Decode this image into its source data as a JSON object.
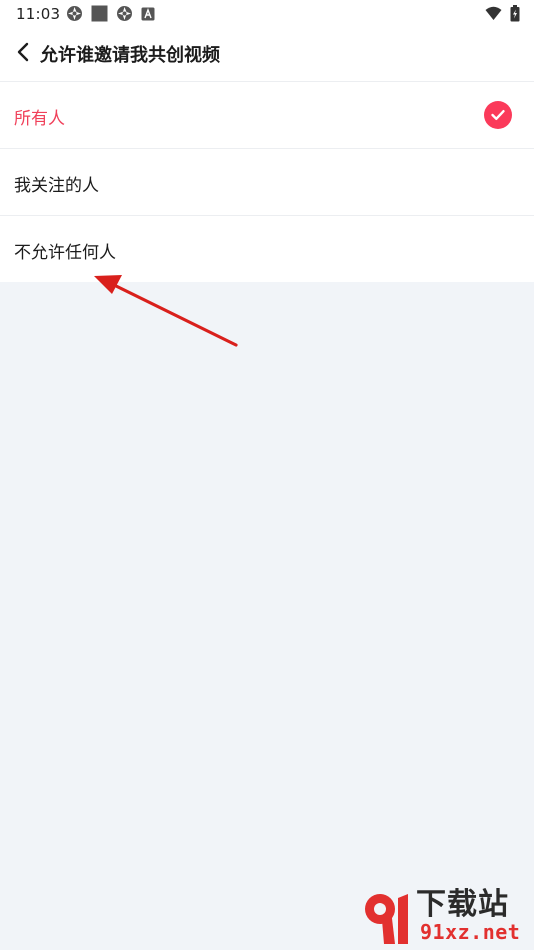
{
  "status_bar": {
    "time": "11:03",
    "left_icons": [
      "aperture-icon",
      "square-icon",
      "aperture-icon",
      "a-badge-icon"
    ],
    "right_icons": [
      "wifi-icon",
      "battery-charging-icon"
    ]
  },
  "header": {
    "back_icon": "chevron-left-icon",
    "title": "允许谁邀请我共创视频"
  },
  "options": [
    {
      "label": "所有人",
      "selected": true
    },
    {
      "label": "我关注的人",
      "selected": false
    },
    {
      "label": "不允许任何人",
      "selected": false
    }
  ],
  "annotation": {
    "arrow_color": "#d9201c"
  },
  "watermark": {
    "top_text": "下载站",
    "bottom_text": "91xz.net"
  },
  "colors": {
    "accent": "#fb3a5a",
    "selected_text": "#f0405a",
    "background": "#f1f4f8"
  }
}
